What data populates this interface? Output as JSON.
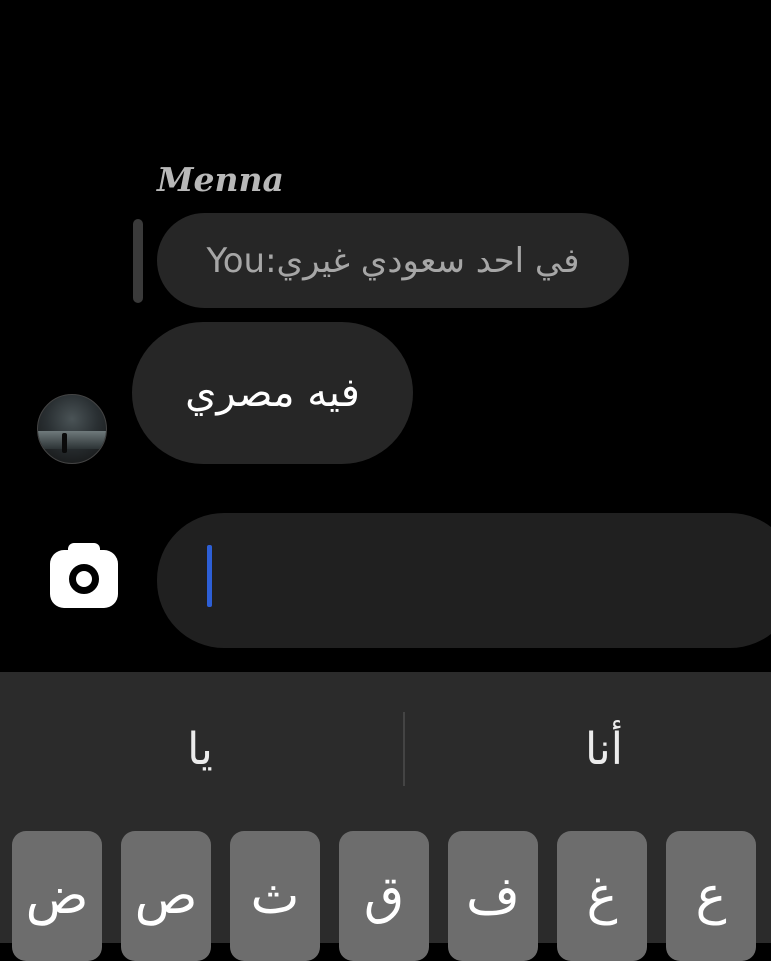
{
  "chat": {
    "sender_name": "Menna",
    "reply": {
      "prefix": "You: ",
      "text": "في احد سعودي غيري"
    },
    "message": {
      "text": "فيه مصري"
    }
  },
  "composer": {
    "value": ""
  },
  "keyboard": {
    "suggestions": [
      "يا",
      "أنا"
    ],
    "keys": [
      "ض",
      "ص",
      "ث",
      "ق",
      "ف",
      "غ",
      "ع"
    ]
  },
  "colors": {
    "background": "#000000",
    "bubble": "#262626",
    "composer": "#202020",
    "keyboard": "#2b2b2b",
    "key": "#6d6d6d",
    "caret": "#2d5fd6"
  }
}
